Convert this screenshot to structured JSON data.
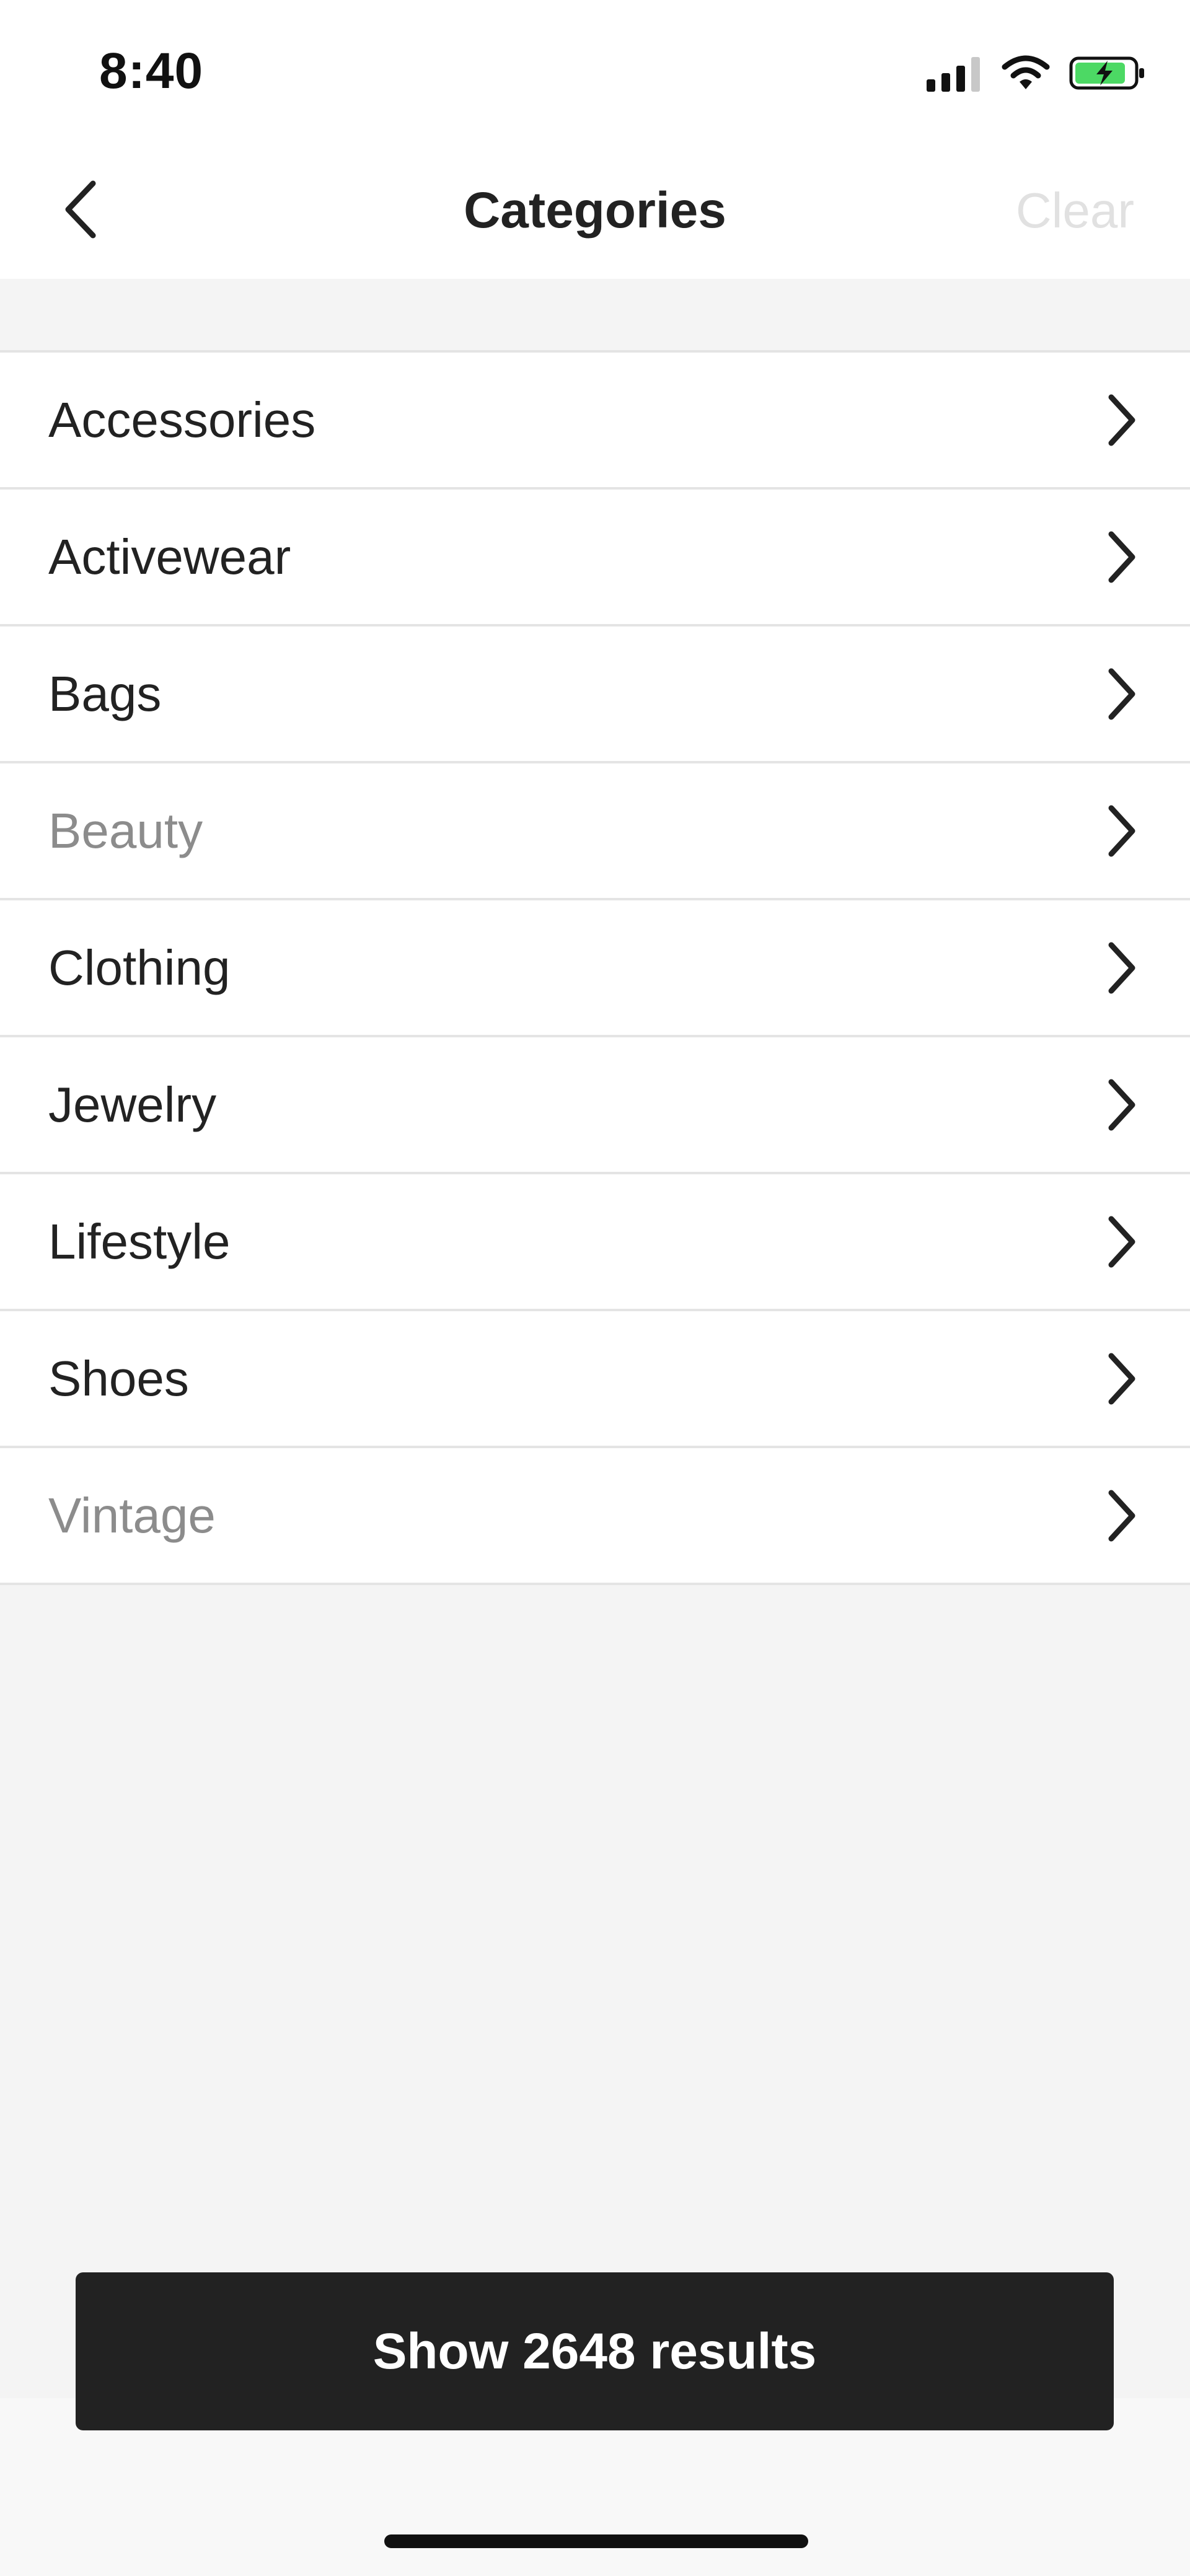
{
  "status_bar": {
    "time": "8:40"
  },
  "header": {
    "title": "Categories",
    "clear_label": "Clear"
  },
  "categories": [
    {
      "label": "Accessories",
      "muted": false
    },
    {
      "label": "Activewear",
      "muted": false
    },
    {
      "label": "Bags",
      "muted": false
    },
    {
      "label": "Beauty",
      "muted": true
    },
    {
      "label": "Clothing",
      "muted": false
    },
    {
      "label": "Jewelry",
      "muted": false
    },
    {
      "label": "Lifestyle",
      "muted": false
    },
    {
      "label": "Shoes",
      "muted": false
    },
    {
      "label": "Vintage",
      "muted": true
    }
  ],
  "footer": {
    "cta_label": "Show 2648 results"
  },
  "colors": {
    "text": "#222222",
    "muted_text": "#8c8c8c",
    "clear_disabled": "#e1e1e1",
    "cta_bg": "#222222",
    "battery_green": "#4cd964"
  }
}
